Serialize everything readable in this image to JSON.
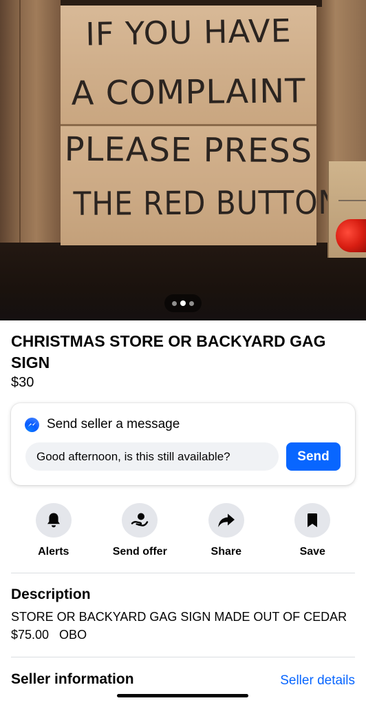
{
  "listing": {
    "photo": {
      "sign_lines": [
        "IF YOU HAVE",
        "A COMPLAINT",
        "PLEASE PRESS",
        "THE RED BUTTON"
      ],
      "page_count": 3,
      "current_page": 2
    },
    "title": "CHRISTMAS STORE OR BACKYARD GAG SIGN",
    "price": "$30"
  },
  "message": {
    "heading": "Send seller a message",
    "icon": "messenger-icon",
    "input_value": "Good afternoon, is this still available?",
    "send_label": "Send"
  },
  "actions": [
    {
      "label": "Alerts",
      "icon": "bell-icon"
    },
    {
      "label": "Send offer",
      "icon": "offer-icon"
    },
    {
      "label": "Share",
      "icon": "share-icon"
    },
    {
      "label": "Save",
      "icon": "bookmark-icon"
    }
  ],
  "description": {
    "heading": "Description",
    "body": "STORE OR BACKYARD GAG SIGN MADE OUT OF CEDAR\n$75.00   OBO"
  },
  "seller": {
    "heading": "Seller information",
    "link": "Seller details"
  },
  "colors": {
    "accent": "#0866ff",
    "button_bg": "#e4e6eb",
    "input_bg": "#f0f2f5",
    "divider": "#dadde1"
  }
}
